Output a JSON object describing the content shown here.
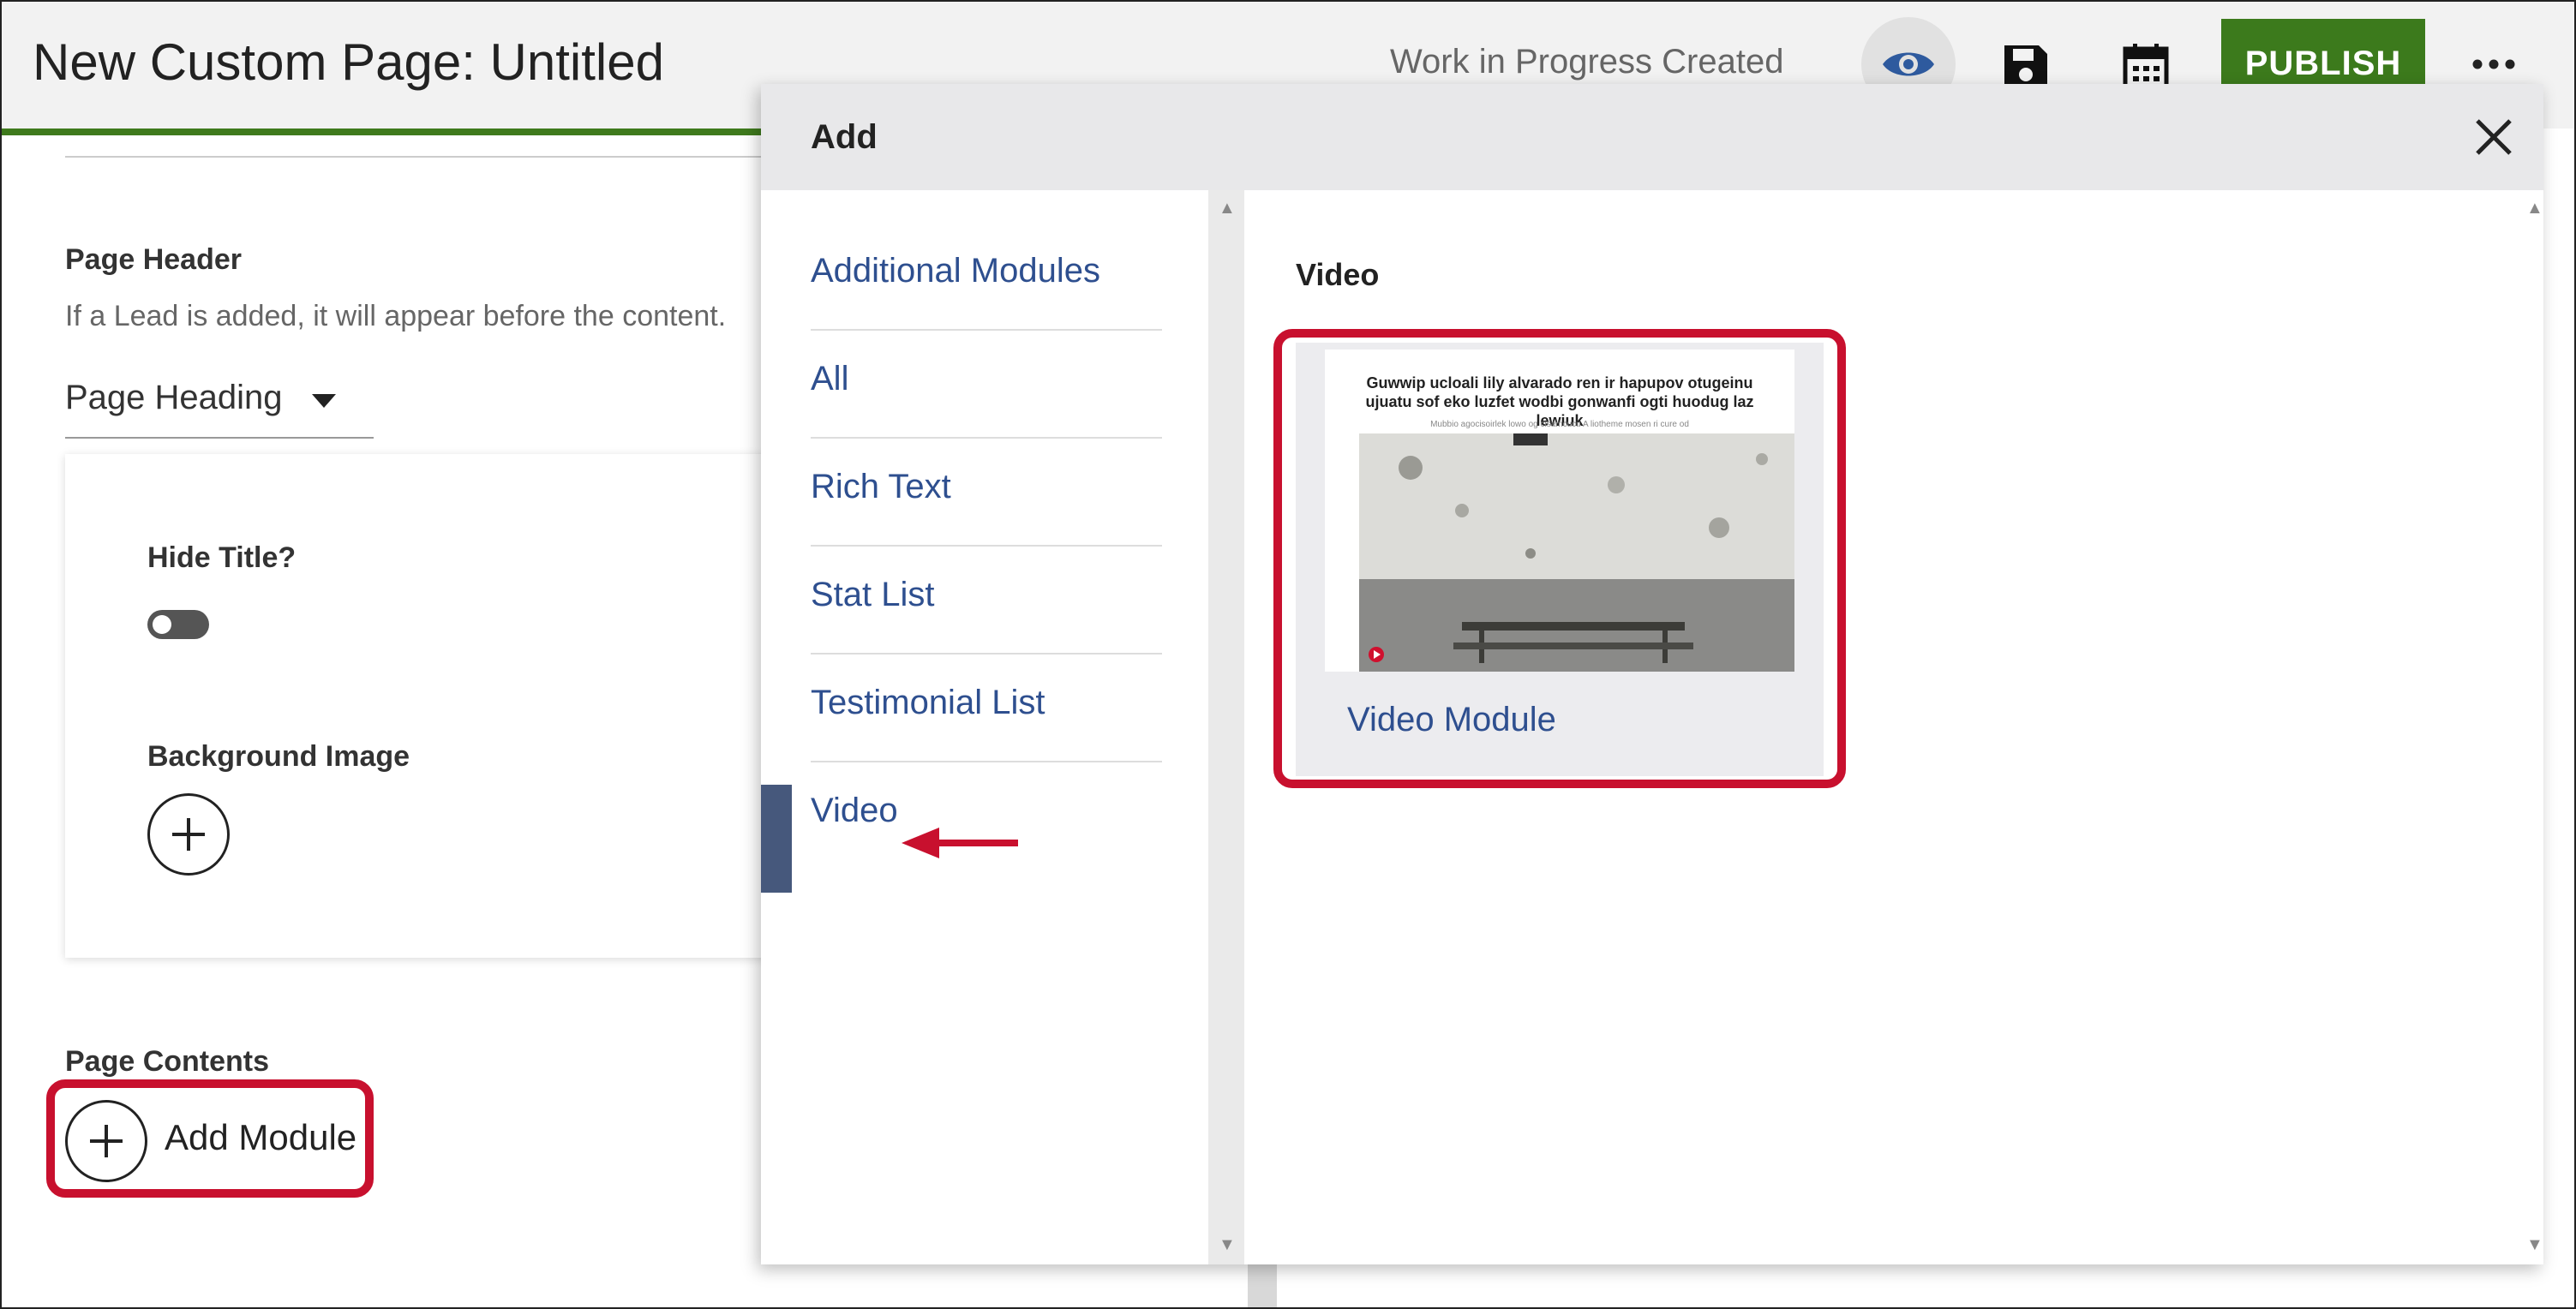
{
  "header": {
    "page_title": "New Custom Page: Untitled",
    "status": "Work in Progress Created",
    "publish_label": "PUBLISH",
    "icons": [
      "eye-icon",
      "save-icon",
      "calendar-icon",
      "more-icon"
    ]
  },
  "form": {
    "page_header_label": "Page Header",
    "page_header_desc": "If a Lead is added, it will appear before the content.",
    "heading_select_value": "Page Heading",
    "hide_title_label": "Hide Title?",
    "hide_title_on": false,
    "background_image_label": "Background Image",
    "page_contents_label": "Page Contents",
    "add_module_label": "Add Module"
  },
  "modal": {
    "title": "Add",
    "categories": [
      {
        "label": "Additional Modules"
      },
      {
        "label": "All"
      },
      {
        "label": "Rich Text"
      },
      {
        "label": "Stat List"
      },
      {
        "label": "Testimonial List"
      },
      {
        "label": "Video"
      }
    ],
    "selected_category": "Video",
    "section_title": "Video",
    "module_tile": {
      "label": "Video Module",
      "thumbnail_heading": "Guwwip ucloali lily alvarado ren ir hapupov otugeinu ujuatu sof eko luzfet wodbi gonwanfi ogti huodug laz lewiuk",
      "thumbnail_subtext": "Mubbio agocisoirlek lowo og cisamcucu A liotheme mosen ri cure od"
    }
  },
  "annotations": {
    "highlight_color": "#c8102e"
  },
  "colors": {
    "brand_green": "#3c7a1c",
    "link_blue": "#2e4f8f",
    "active_bar": "#46587c"
  }
}
